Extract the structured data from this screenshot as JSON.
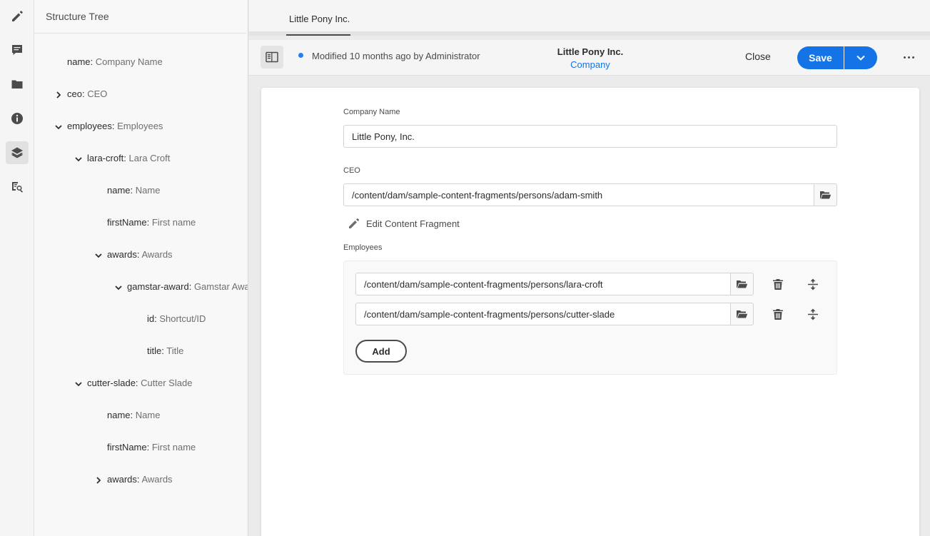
{
  "rail": {
    "icons": [
      "pencil-icon",
      "comment-icon",
      "folder-icon",
      "info-icon",
      "layers-icon",
      "inspect-icon"
    ],
    "active": "layers-icon"
  },
  "tree": {
    "title": "Structure Tree",
    "nodes": [
      {
        "key": "name:",
        "value": "Company Name"
      },
      {
        "key": "ceo:",
        "value": "CEO"
      },
      {
        "key": "employees:",
        "value": "Employees"
      },
      {
        "key": "lara-croft:",
        "value": "Lara Croft"
      },
      {
        "key": "name:",
        "value": "Name"
      },
      {
        "key": "firstName:",
        "value": "First name"
      },
      {
        "key": "awards:",
        "value": "Awards"
      },
      {
        "key": "gamstar-award:",
        "value": "Gamstar Award"
      },
      {
        "key": "id:",
        "value": "Shortcut/ID"
      },
      {
        "key": "title:",
        "value": "Title"
      },
      {
        "key": "cutter-slade:",
        "value": "Cutter Slade"
      },
      {
        "key": "name:",
        "value": "Name"
      },
      {
        "key": "firstName:",
        "value": "First name"
      },
      {
        "key": "awards:",
        "value": "Awards"
      }
    ]
  },
  "tabs": [
    {
      "label": "Little Pony Inc."
    }
  ],
  "header": {
    "status": "Modified 10 months ago by Administrator",
    "title": "Little Pony Inc.",
    "model": "Company",
    "close_label": "Close",
    "save_label": "Save",
    "accent": "#1473e6"
  },
  "form": {
    "company_name_label": "Company Name",
    "company_name_value": "Little Pony, Inc.",
    "ceo_label": "CEO",
    "ceo_value": "/content/dam/sample-content-fragments/persons/adam-smith",
    "edit_fragment_label": "Edit Content Fragment",
    "employees_label": "Employees",
    "employees": [
      "/content/dam/sample-content-fragments/persons/lara-croft",
      "/content/dam/sample-content-fragments/persons/cutter-slade"
    ],
    "add_label": "Add"
  }
}
